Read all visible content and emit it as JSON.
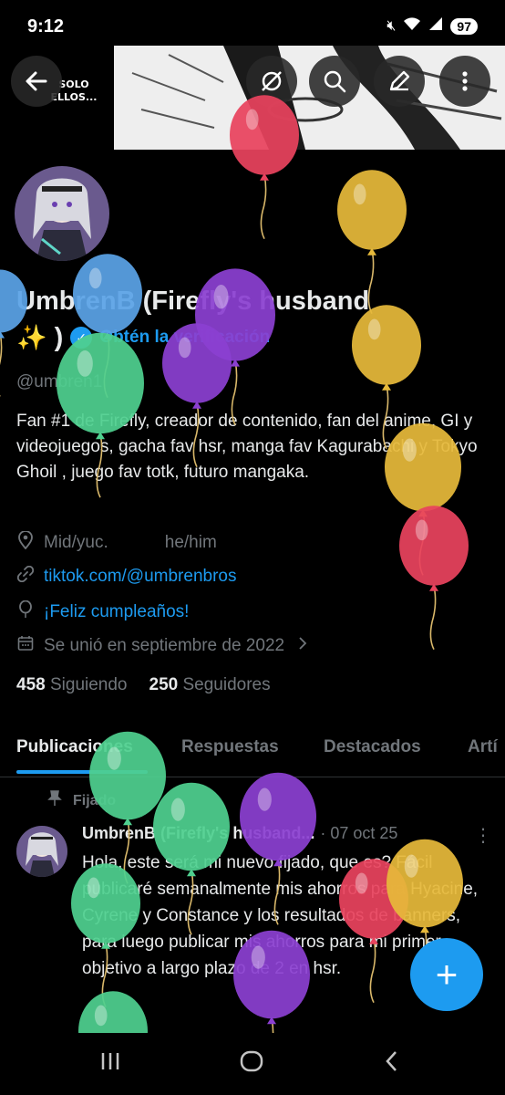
{
  "status_bar": {
    "time": "9:12",
    "battery": "97"
  },
  "header": {
    "back_label": "Back",
    "sticker_text": "SOLO ELLOS..."
  },
  "profile": {
    "name_line1": "UmbrenB (Firefly's husband",
    "name_emoji": "✨",
    "name_close": ")",
    "get_verified": "Obtén la verificación",
    "handle": "@umbren1",
    "bio": "Fan #1 de Firefly, creador de contenido, fan del anime, GI y videojuegos, gacha fav hsr, manga fav Kagurabachi y Tokyo Ghoil , juego fav totk, futuro mangaka.",
    "location": "Mid/yuc.",
    "pronouns": "he/him",
    "link": "tiktok.com/@umbrenbros",
    "birthday": "¡Feliz cumpleaños!",
    "joined": "Se unió en septiembre de 2022",
    "following_count": "458",
    "following_label": "Siguiendo",
    "followers_count": "250",
    "followers_label": "Seguidores"
  },
  "tabs": [
    "Publicaciones",
    "Respuestas",
    "Destacados",
    "Artí"
  ],
  "pinned_post": {
    "pinned_label": "Fijado",
    "author": "UmbrenB (Firefly's husband...",
    "date": "· 07 oct 25",
    "text": "Hola, este será mi nuevo fijado, que es? Fácil publicaré semanalmente mis ahorros para Hyacine, Cyrene y Constance y los resultados de banners, para luego publicar mis ahorros para mi primer objetivo a largo plazo de 2 en hsr."
  },
  "fab_label": "+",
  "icons": {
    "back": "arrow-left-icon",
    "hide": "eye-slash-icon",
    "search": "search-icon",
    "edit": "pencil-icon",
    "more": "more-vertical-icon",
    "location": "location-pin-icon",
    "link": "link-icon",
    "birthday": "balloon-icon",
    "calendar": "calendar-icon",
    "pin": "pin-icon"
  },
  "balloon_colors": [
    "#e8435e",
    "#e6b93a",
    "#5aa3e6",
    "#8b3fd1",
    "#4fd08f"
  ],
  "colors": {
    "accent": "#1d9bf0",
    "muted": "#71767b",
    "text": "#e7e9ea"
  }
}
